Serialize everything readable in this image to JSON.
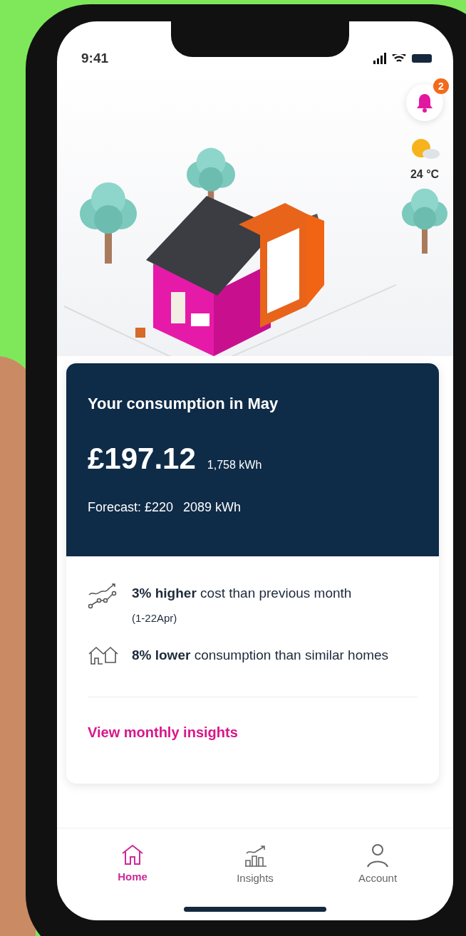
{
  "status_bar": {
    "time": "9:41"
  },
  "notifications": {
    "count": "2"
  },
  "weather": {
    "temperature": "24 °C"
  },
  "consumption_card": {
    "title": "Your consumption in May",
    "cost": "£197.12",
    "energy": "1,758 kWh",
    "forecast": "Forecast: £220",
    "forecast_energy": "2089 kWh",
    "insights": [
      {
        "kind": "trend",
        "text": "**3% higher** cost than previous month",
        "note": "(1-22Apr)"
      },
      {
        "kind": "homes",
        "text": "**8% lower** consumption than similar homes"
      }
    ],
    "link": "View monthly insights"
  },
  "nav": [
    {
      "kind": "home",
      "label": "Home",
      "selected": true
    },
    {
      "kind": "insights",
      "label": "Insights",
      "selected": false
    },
    {
      "kind": "account",
      "label": "Account",
      "selected": false
    }
  ]
}
